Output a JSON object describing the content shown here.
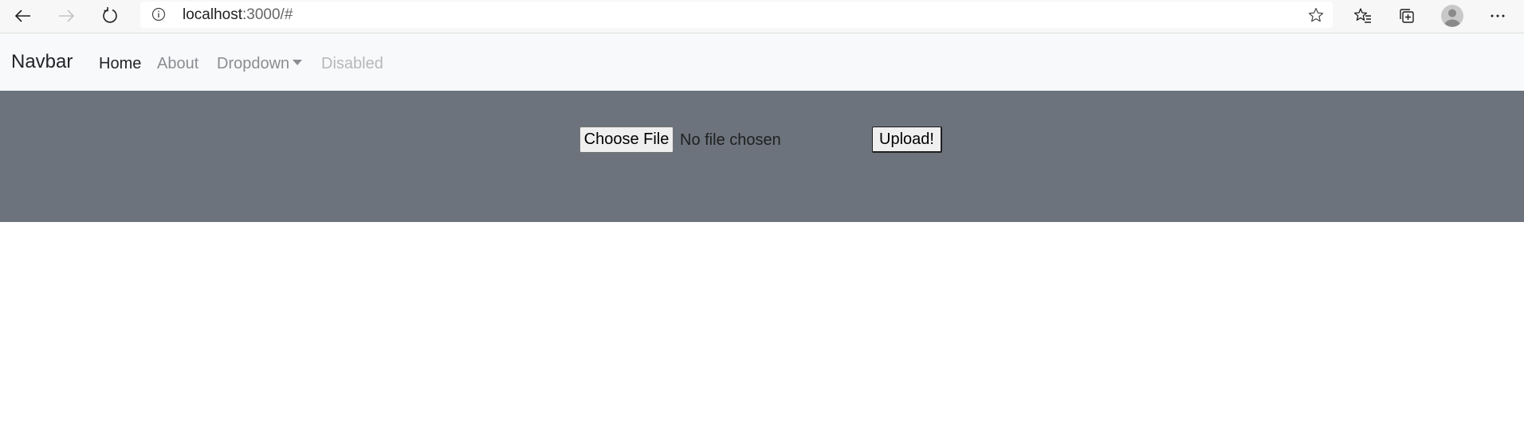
{
  "browser": {
    "url_host": "localhost",
    "url_rest": ":3000/#"
  },
  "navbar": {
    "brand": "Navbar",
    "links": [
      {
        "label": "Home",
        "state": "active"
      },
      {
        "label": "About",
        "state": "normal"
      },
      {
        "label": "Dropdown",
        "state": "dropdown"
      },
      {
        "label": "Disabled",
        "state": "disabled"
      }
    ]
  },
  "upload": {
    "choose_label": "Choose File",
    "status_text": "No file chosen",
    "submit_label": "Upload!"
  },
  "colors": {
    "navbar_bg": "#f8f9fa",
    "panel_bg": "#6c737c",
    "text_dark": "#212529",
    "text_muted": "#8a8d91"
  },
  "icons": [
    "back-arrow-icon",
    "forward-arrow-icon",
    "refresh-icon",
    "info-icon",
    "star-icon",
    "favorites-icon",
    "collections-icon",
    "profile-icon",
    "more-icon"
  ]
}
